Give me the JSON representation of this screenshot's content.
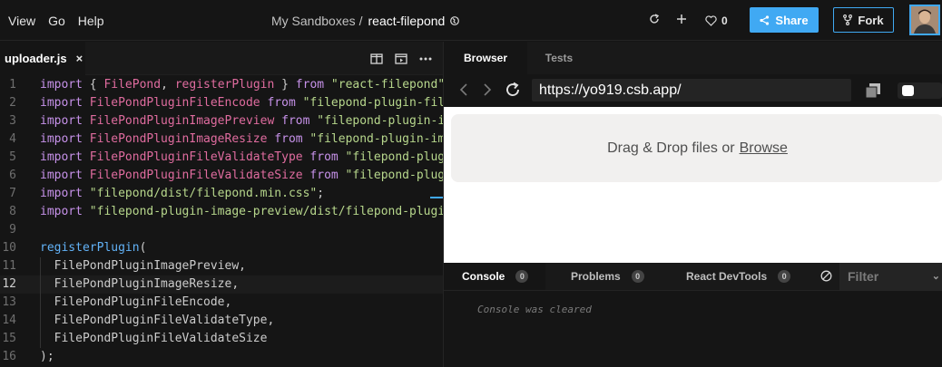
{
  "menu": {
    "items": [
      "View",
      "Go",
      "Help"
    ]
  },
  "breadcrumb": {
    "parent": "My Sandboxes",
    "separator": "/",
    "name": "react-filepond"
  },
  "header": {
    "like_count": "0",
    "share_label": "Share",
    "fork_label": "Fork"
  },
  "editor": {
    "file_tab": {
      "name": "uploader.js",
      "close": "×"
    },
    "active_line": 12,
    "lines": [
      [
        [
          "kw",
          "import"
        ],
        [
          "pl",
          " { "
        ],
        [
          "id",
          "FilePond"
        ],
        [
          "pl",
          ", "
        ],
        [
          "id",
          "registerPlugin"
        ],
        [
          "pl",
          " } "
        ],
        [
          "kw",
          "from"
        ],
        [
          "str",
          " \"react-filepond\""
        ],
        [
          "pl",
          ";"
        ]
      ],
      [
        [
          "kw",
          "import"
        ],
        [
          "id",
          " FilePondPluginFileEncode "
        ],
        [
          "kw",
          "from"
        ],
        [
          "str",
          " \"filepond-plugin-file-encode\""
        ],
        [
          "pl",
          ";"
        ]
      ],
      [
        [
          "kw",
          "import"
        ],
        [
          "id",
          " FilePondPluginImagePreview "
        ],
        [
          "kw",
          "from"
        ],
        [
          "str",
          " \"filepond-plugin-image-preview\""
        ],
        [
          "pl",
          ";"
        ]
      ],
      [
        [
          "kw",
          "import"
        ],
        [
          "id",
          " FilePondPluginImageResize "
        ],
        [
          "kw",
          "from"
        ],
        [
          "str",
          " \"filepond-plugin-image-resize\""
        ],
        [
          "pl",
          ";"
        ]
      ],
      [
        [
          "kw",
          "import"
        ],
        [
          "id",
          " FilePondPluginFileValidateType "
        ],
        [
          "kw",
          "from"
        ],
        [
          "str",
          " \"filepond-plugin-file-validate-type\""
        ],
        [
          "pl",
          ";"
        ]
      ],
      [
        [
          "kw",
          "import"
        ],
        [
          "id",
          " FilePondPluginFileValidateSize "
        ],
        [
          "kw",
          "from"
        ],
        [
          "str",
          " \"filepond-plugin-file-validate-size\""
        ],
        [
          "pl",
          ";"
        ]
      ],
      [
        [
          "kw",
          "import"
        ],
        [
          "str",
          " \"filepond/dist/filepond.min.css\""
        ],
        [
          "pl",
          ";"
        ]
      ],
      [
        [
          "kw",
          "import"
        ],
        [
          "str",
          " \"filepond-plugin-image-preview/dist/filepond-plugin-image-preview.css\""
        ],
        [
          "pl",
          ";"
        ]
      ],
      [],
      [
        [
          "fn",
          "registerPlugin"
        ],
        [
          "pl",
          "("
        ]
      ],
      [
        [
          "pl",
          "  FilePondPluginImagePreview,"
        ]
      ],
      [
        [
          "pl",
          "  FilePondPluginImageResize,"
        ]
      ],
      [
        [
          "pl",
          "  FilePondPluginFileEncode,"
        ]
      ],
      [
        [
          "pl",
          "  FilePondPluginFileValidateType,"
        ]
      ],
      [
        [
          "pl",
          "  FilePondPluginFileValidateSize"
        ]
      ],
      [
        [
          "pl",
          ");"
        ]
      ]
    ]
  },
  "preview": {
    "tabs": {
      "browser": "Browser",
      "tests": "Tests"
    },
    "url": "https://yo919.csb.app/",
    "dropzone": {
      "text": "Drag & Drop files or",
      "link": "Browse"
    }
  },
  "console": {
    "tabs": [
      {
        "label": "Console",
        "count": "0"
      },
      {
        "label": "Problems",
        "count": "0"
      },
      {
        "label": "React DevTools",
        "count": "0"
      }
    ],
    "filter_placeholder": "Filter",
    "message": "Console was cleared"
  },
  "colors": {
    "accent": "#40a9f3",
    "keyword": "#c792ea",
    "identifier": "#e06c9f",
    "string": "#b7d78c",
    "function": "#62b2f7"
  }
}
